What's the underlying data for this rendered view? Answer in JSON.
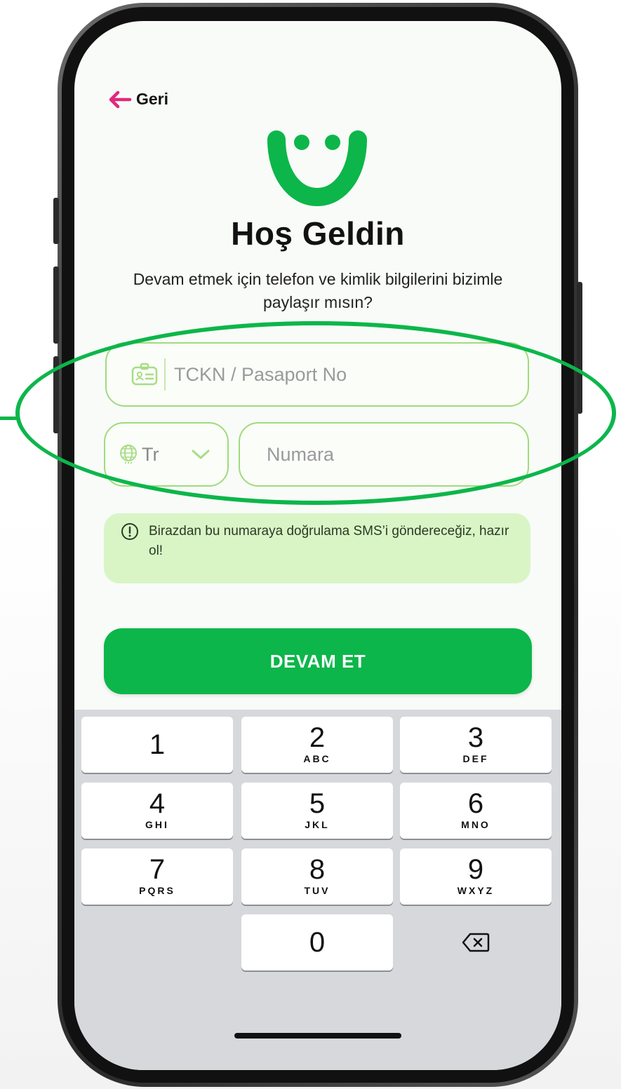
{
  "header": {
    "back_label": "Geri"
  },
  "welcome": {
    "title": "Hoş Geldin",
    "subtitle": "Devam etmek için telefon ve kimlik bilgilerini bizimle paylaşır mısın?"
  },
  "form": {
    "id_placeholder": "TCKN / Pasaport No",
    "country_code": "Tr",
    "phone_placeholder": "Numara"
  },
  "info": {
    "text": "Birazdan bu numaraya doğrulama SMS’i göndereceğiz, hazır ol!"
  },
  "cta": {
    "label": "DEVAM ET"
  },
  "keypad": {
    "keys": [
      {
        "digit": "1",
        "letters": ""
      },
      {
        "digit": "2",
        "letters": "ABC"
      },
      {
        "digit": "3",
        "letters": "DEF"
      },
      {
        "digit": "4",
        "letters": "GHI"
      },
      {
        "digit": "5",
        "letters": "JKL"
      },
      {
        "digit": "6",
        "letters": "MNO"
      },
      {
        "digit": "7",
        "letters": "PQRS"
      },
      {
        "digit": "8",
        "letters": "TUV"
      },
      {
        "digit": "9",
        "letters": "WXYZ"
      },
      {
        "digit": "0",
        "letters": ""
      }
    ]
  },
  "colors": {
    "brand_green": "#0cb64a",
    "input_border": "#9fdc7a",
    "info_bg": "#d9f5c6",
    "back_arrow": "#e0297c"
  },
  "icons": {
    "back": "arrow-left-icon",
    "id_card": "id-card-icon",
    "globe": "globe-icon",
    "chevron": "chevron-down-icon",
    "info": "info-circle-icon",
    "delete": "backspace-icon"
  }
}
